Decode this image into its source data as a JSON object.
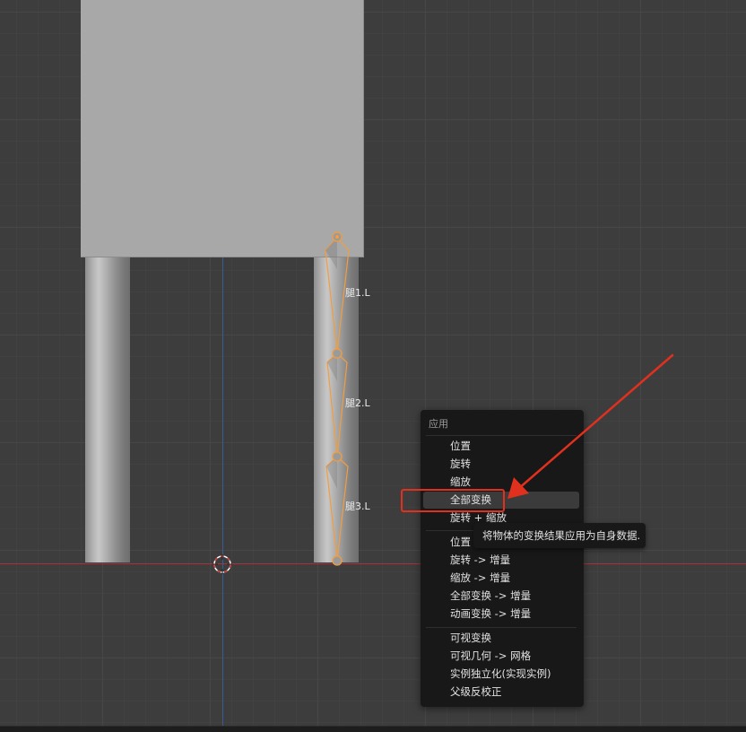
{
  "viewport": {
    "bones": [
      {
        "label": "腿1.L"
      },
      {
        "label": "腿2.L"
      },
      {
        "label": "腿3.L"
      }
    ]
  },
  "apply_menu": {
    "title": "应用",
    "group1": [
      "位置",
      "旋转",
      "缩放",
      "全部变换",
      "旋转 + 缩放"
    ],
    "highlighted": "全部变换",
    "group2": [
      "位置 -> 增量",
      "旋转 -> 增量",
      "缩放 -> 增量",
      "全部变换 -> 增量",
      "动画变换 -> 增量"
    ],
    "group3": [
      "可视变换",
      "可视几何 -> 网格",
      "实例独立化(实现实例)",
      "父级反校正"
    ]
  },
  "tooltip": {
    "text": "将物体的变换结果应用为自身数据."
  },
  "colors": {
    "bone_outline": "#f29d3f",
    "annotation_red": "#e0301e",
    "axis_x": "#a8323a",
    "axis_y": "#3a5a9a"
  }
}
